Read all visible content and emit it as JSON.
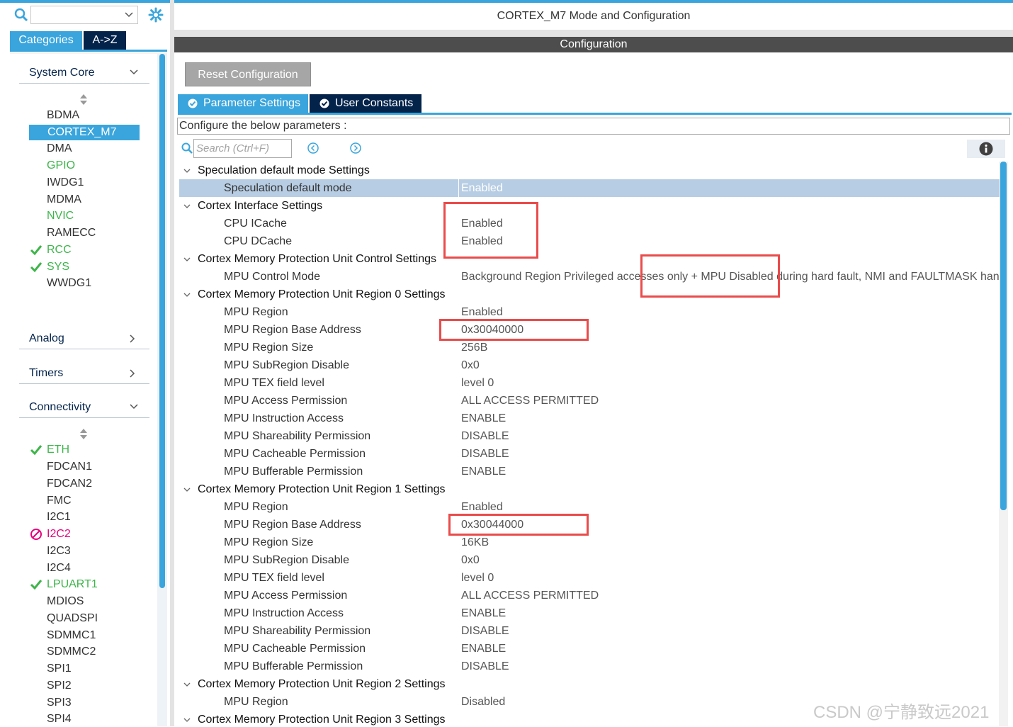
{
  "left_panel": {
    "search_value": "",
    "tabs": {
      "categories": "Categories",
      "az": "A->Z"
    },
    "system_core": {
      "label": "System Core",
      "items": [
        "BDMA",
        "CORTEX_M7",
        "DMA",
        "GPIO",
        "IWDG1",
        "MDMA",
        "NVIC",
        "RAMECC",
        "RCC",
        "SYS",
        "WWDG1"
      ]
    },
    "analog": {
      "label": "Analog"
    },
    "timers": {
      "label": "Timers"
    },
    "connectivity": {
      "label": "Connectivity",
      "items": [
        "ETH",
        "FDCAN1",
        "FDCAN2",
        "FMC",
        "I2C1",
        "I2C2",
        "I2C3",
        "I2C4",
        "LPUART1",
        "MDIOS",
        "QUADSPI",
        "SDMMC1",
        "SDMMC2",
        "SPI1",
        "SPI2",
        "SPI3",
        "SPI4"
      ]
    }
  },
  "right_panel": {
    "title": "CORTEX_M7 Mode and Configuration",
    "config_bar": "Configuration",
    "reset_button": "Reset Configuration",
    "tabs": {
      "parameter_settings": "Parameter Settings",
      "user_constants": "User Constants"
    },
    "description": "Configure the below parameters :",
    "search_placeholder": "Search (Ctrl+F)",
    "parameters": [
      {
        "group": "Speculation default mode Settings"
      },
      {
        "name": "Speculation default mode",
        "value": "Enabled"
      },
      {
        "group": "Cortex Interface Settings"
      },
      {
        "name": "CPU ICache",
        "value": "Enabled"
      },
      {
        "name": "CPU DCache",
        "value": "Enabled"
      },
      {
        "group": "Cortex Memory Protection Unit Control Settings"
      },
      {
        "name": "MPU Control Mode",
        "value": "Background Region Privileged accesses only + MPU Disabled during hard fault, NMI and FAULTMASK handlers"
      },
      {
        "group": "Cortex Memory Protection Unit Region 0 Settings"
      },
      {
        "name": "MPU Region",
        "value": "Enabled"
      },
      {
        "name": "MPU Region Base Address",
        "value": "0x30040000"
      },
      {
        "name": "MPU Region Size",
        "value": "256B"
      },
      {
        "name": "MPU SubRegion Disable",
        "value": "0x0"
      },
      {
        "name": "MPU TEX field level",
        "value": "level 0"
      },
      {
        "name": "MPU Access Permission",
        "value": "ALL ACCESS PERMITTED"
      },
      {
        "name": "MPU Instruction Access",
        "value": "ENABLE"
      },
      {
        "name": "MPU Shareability Permission",
        "value": "DISABLE"
      },
      {
        "name": "MPU Cacheable Permission",
        "value": "DISABLE"
      },
      {
        "name": "MPU Bufferable  Permission",
        "value": "ENABLE"
      },
      {
        "group": "Cortex Memory Protection Unit Region 1 Settings"
      },
      {
        "name": "MPU Region",
        "value": "Enabled"
      },
      {
        "name": "MPU Region Base Address",
        "value": "0x30044000"
      },
      {
        "name": "MPU Region Size",
        "value": "16KB"
      },
      {
        "name": "MPU SubRegion Disable",
        "value": "0x0"
      },
      {
        "name": "MPU TEX field level",
        "value": "level 0"
      },
      {
        "name": "MPU Access Permission",
        "value": "ALL ACCESS PERMITTED"
      },
      {
        "name": "MPU Instruction Access",
        "value": "ENABLE"
      },
      {
        "name": "MPU Shareability Permission",
        "value": "DISABLE"
      },
      {
        "name": "MPU Cacheable Permission",
        "value": "ENABLE"
      },
      {
        "name": "MPU Bufferable  Permission",
        "value": "DISABLE"
      },
      {
        "group": "Cortex Memory Protection Unit Region 2 Settings"
      },
      {
        "name": "MPU Region",
        "value": "Disabled"
      },
      {
        "group": "Cortex Memory Protection Unit Region 3 Settings"
      }
    ]
  },
  "watermark": "CSDN @宁静致远2021",
  "colors": {
    "accent": "#3aa5dc",
    "dark_tab": "#03234b",
    "config_bar": "#4d4d4d",
    "ok_green": "#3db54a",
    "error_pink": "#e6007e",
    "highlight_red": "#ea4b4b",
    "selected_row": "#b7cde3"
  }
}
